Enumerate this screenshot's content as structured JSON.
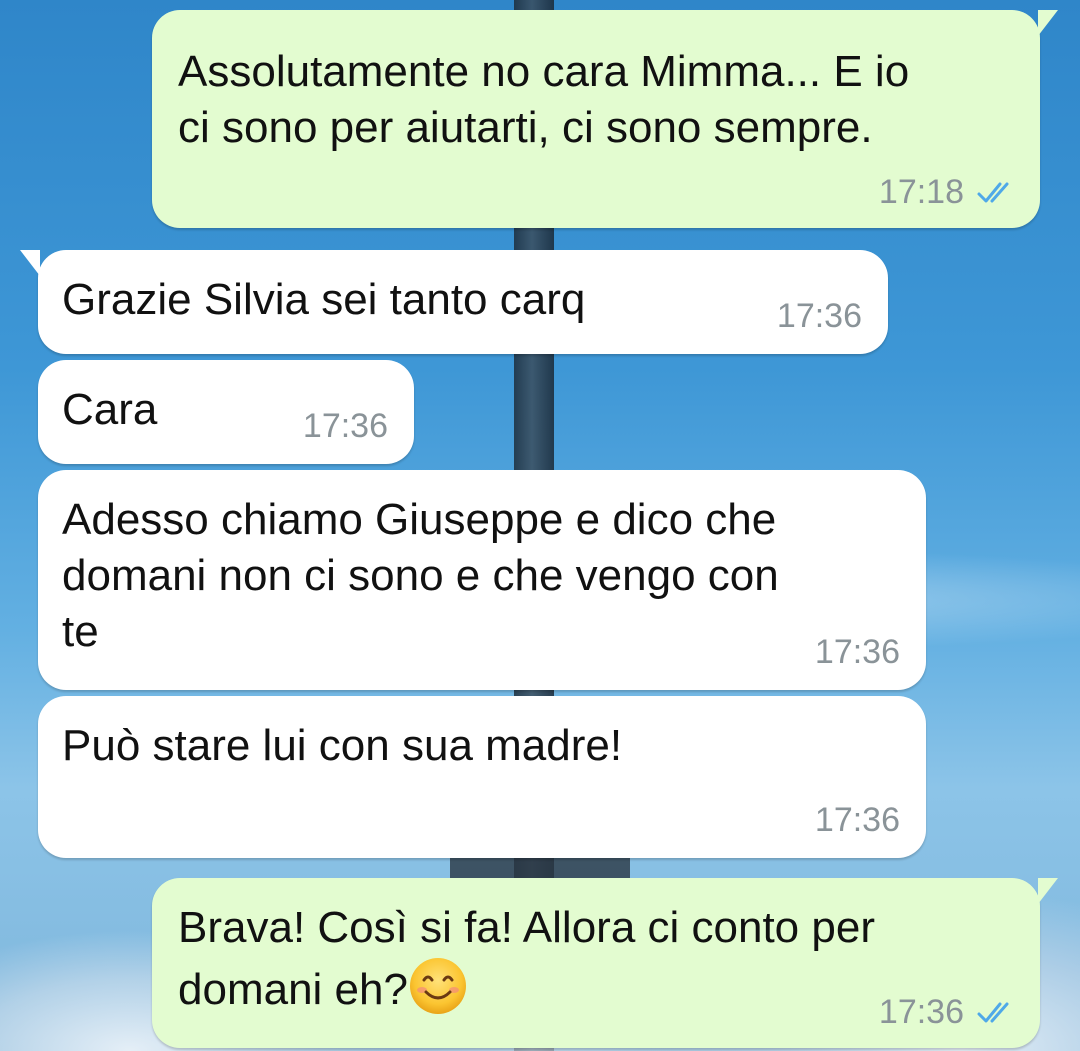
{
  "messages": [
    {
      "direction": "outgoing",
      "text": "Assolutamente no cara Mimma... E io\nci sono per aiutarti, ci sono sempre.",
      "time": "17:18",
      "status": "read"
    },
    {
      "direction": "incoming",
      "text": "Grazie Silvia sei tanto carq",
      "time": "17:36"
    },
    {
      "direction": "incoming",
      "text": "Cara",
      "time": "17:36"
    },
    {
      "direction": "incoming",
      "text": "Adesso chiamo Giuseppe e dico che\ndomani non ci sono e che vengo con\nte",
      "time": "17:36"
    },
    {
      "direction": "incoming",
      "text": "Può stare lui con sua madre!",
      "time": "17:36"
    },
    {
      "direction": "outgoing",
      "text": "Brava! Così si fa! Allora ci conto per\ndomani eh?",
      "emoji": "smiling-face-emoji",
      "time": "17:36",
      "status": "read"
    }
  ],
  "colors": {
    "outgoing_bubble": "#e3fcd0",
    "incoming_bubble": "#ffffff",
    "timestamp": "#8a9398",
    "read_ticks": "#4fa9e8"
  }
}
